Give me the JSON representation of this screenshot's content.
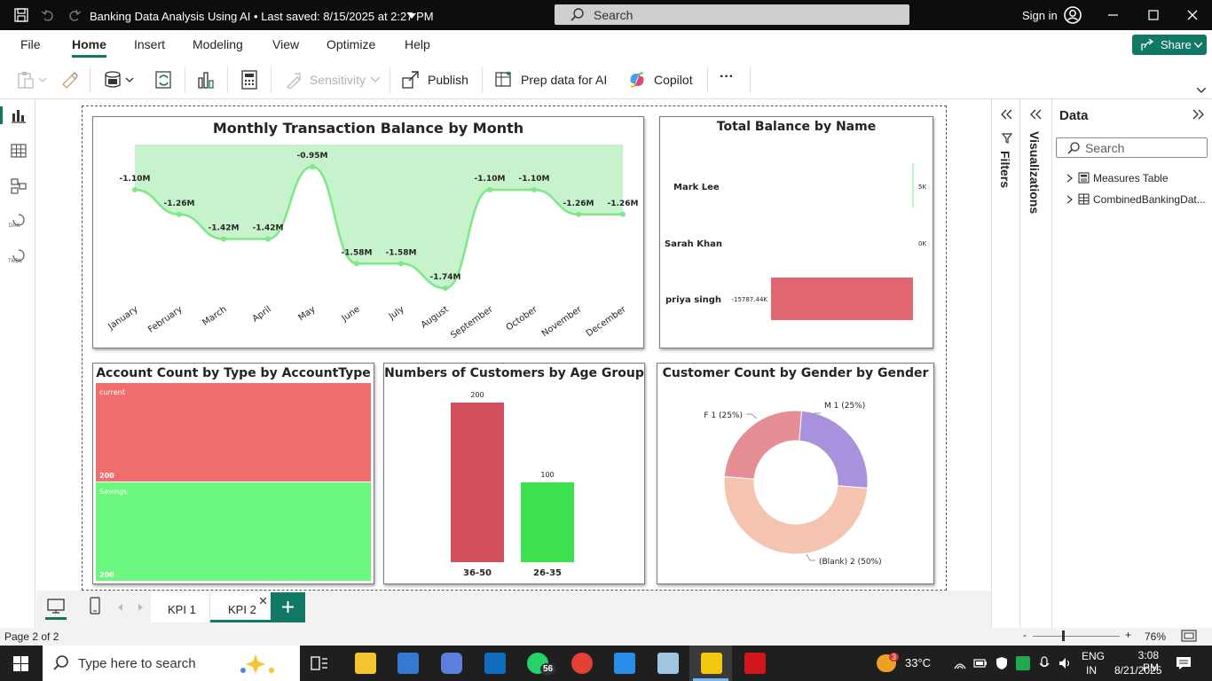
{
  "app": {
    "title": "Banking Data Analysis Using AI",
    "saved_status": "Last saved: 8/15/2025 at 2:27 PM",
    "search_placeholder": "Search",
    "sign_in": "Sign in"
  },
  "menu": {
    "items": [
      "File",
      "Home",
      "Insert",
      "Modeling",
      "View",
      "Optimize",
      "Help"
    ],
    "active": "Home",
    "share_label": "Share"
  },
  "ribbon": {
    "sensitivity": "Sensitivity",
    "publish": "Publish",
    "prep_data": "Prep data for AI",
    "copilot": "Copilot",
    "more": "···"
  },
  "panes": {
    "filters_label": "Filters",
    "visualizations_label": "Visualizations",
    "data_title": "Data",
    "data_search_placeholder": "Search",
    "data_items": [
      "Measures Table",
      "CombinedBankingDat..."
    ]
  },
  "leftbar": {
    "tmdl": "TMDL",
    "dax": "DAX"
  },
  "pages": {
    "tabs": [
      "KPI 1",
      "KPI 2"
    ],
    "active": "KPI 2",
    "status": "Page 2 of 2"
  },
  "zoom": {
    "level": "76%"
  },
  "taskbar": {
    "search_placeholder": "Type here to search",
    "whatsapp_badge": "56",
    "weather_badge": "3",
    "temperature": "33°C",
    "language_line1": "ENG",
    "language_line2": "IN",
    "time": "3:08 PM",
    "date": "8/21/2025"
  },
  "colors": {
    "accent": "#117865",
    "line_area": "#c6f3cc",
    "line": "#7ee787",
    "red": "#f06e6e",
    "green": "#6cf77f",
    "bar_red": "#d14f5c",
    "bar_green": "#3de04e",
    "bar_pink": "#e06772",
    "donut_purple": "#a992dd",
    "donut_peach": "#f4c4b0",
    "donut_pink": "#e58e96"
  },
  "chart_data": [
    {
      "type": "area",
      "title": "Monthly Transaction Balance by Month",
      "categories": [
        "January",
        "February",
        "March",
        "April",
        "May",
        "June",
        "July",
        "August",
        "September",
        "October",
        "November",
        "December"
      ],
      "values": [
        -1.1,
        -1.26,
        -1.42,
        -1.42,
        -0.95,
        -1.58,
        -1.58,
        -1.74,
        -1.1,
        -1.1,
        -1.26,
        -1.26
      ],
      "labels": [
        "-1.10M",
        "-1.26M",
        "-1.42M",
        "-1.42M",
        "-0.95M",
        "-1.58M",
        "-1.58M",
        "-1.74M",
        "-1.10M",
        "-1.10M",
        "-1.26M",
        "-1.26M"
      ],
      "unit": "M"
    },
    {
      "type": "bar",
      "orientation": "horizontal",
      "title": "Total Balance by Name",
      "categories": [
        "Mark Lee",
        "Sarah Khan",
        "priya singh"
      ],
      "values": [
        5,
        0,
        -15787.44
      ],
      "labels": [
        "5K",
        "0K",
        "-15787.44K"
      ],
      "unit": "K"
    },
    {
      "type": "treemap",
      "title": "Account Count by Type by AccountType",
      "categories": [
        "current",
        "Savings"
      ],
      "values": [
        200,
        200
      ]
    },
    {
      "type": "bar",
      "title": "Numbers of Customers by Age Group",
      "categories": [
        "36-50",
        "26-35"
      ],
      "values": [
        200,
        100
      ]
    },
    {
      "type": "pie",
      "variant": "donut",
      "title": "Customer Count by Gender by Gender",
      "slices": [
        {
          "name": "M",
          "value": 1,
          "label": "M 1 (25%)"
        },
        {
          "name": "(Blank)",
          "value": 2,
          "label": "(Blank) 2 (50%)"
        },
        {
          "name": "F",
          "value": 1,
          "label": "F 1 (25%)"
        }
      ]
    }
  ]
}
